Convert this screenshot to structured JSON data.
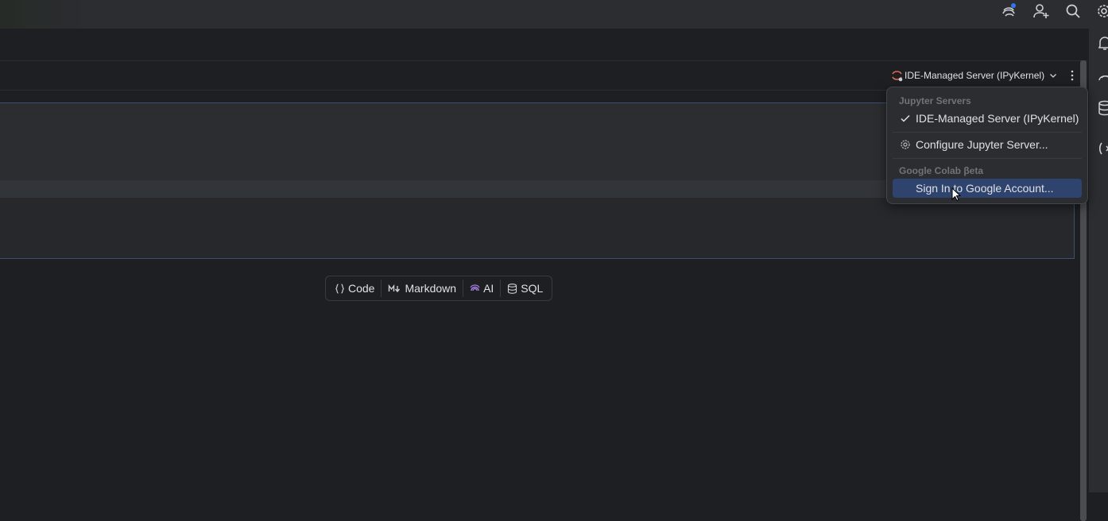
{
  "notebook_toolbar": {
    "kernel_label": "IDE-Managed Server (IPyKernel)"
  },
  "kernel_popup": {
    "jupyter_header": "Jupyter Servers",
    "jupyter_items": [
      "IDE-Managed Server (IPyKernel)",
      "Configure Jupyter Server..."
    ],
    "colab_header": "Google Colab βeta",
    "colab_items": [
      "Sign In to Google Account..."
    ]
  },
  "add_cell_bar": {
    "code_label": "Code",
    "markdown_label": "Markdown",
    "ai_label": "AI",
    "sql_label": "SQL"
  },
  "colors": {
    "background": "#1e1f22",
    "panel": "#2b2d30",
    "selection": "#2e436e",
    "accent_blue": "#3574f0",
    "ai_purple": "#a57fe0",
    "kernel_icon": "#e06c4f"
  }
}
